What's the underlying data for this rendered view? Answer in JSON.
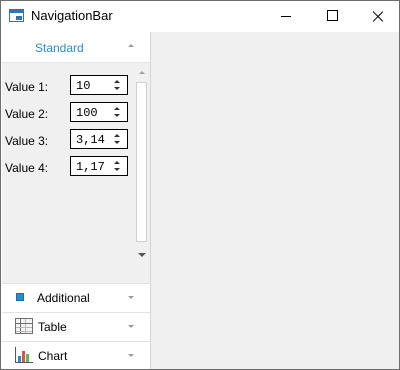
{
  "window": {
    "title": "NavigationBar"
  },
  "navbar": {
    "standard": {
      "label": "Standard",
      "rows": [
        {
          "label": "Value 1:",
          "value": "10"
        },
        {
          "label": "Value 2:",
          "value": "100"
        },
        {
          "label": "Value 3:",
          "value": "3,14"
        },
        {
          "label": "Value 4:",
          "value": "1,17"
        }
      ]
    },
    "groups": [
      {
        "label": "Additional",
        "icon": "square-icon"
      },
      {
        "label": "Table",
        "icon": "table-icon"
      },
      {
        "label": "Chart",
        "icon": "bar-chart-icon"
      }
    ]
  },
  "colors": {
    "accent": "#2e8bc9",
    "content_bg": "#f0f0f0"
  }
}
